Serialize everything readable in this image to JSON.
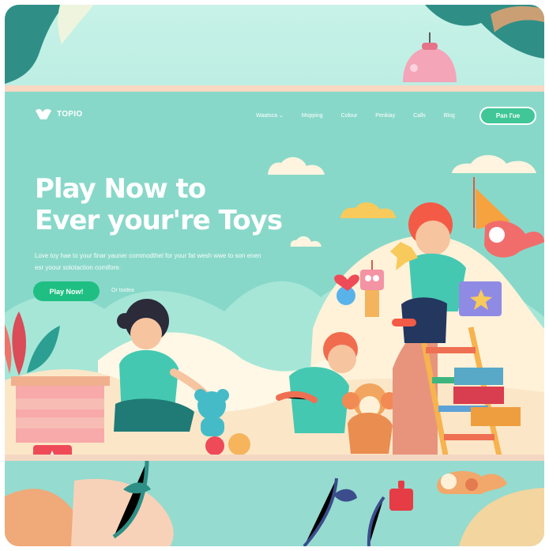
{
  "header": {
    "brand": "TOPIO"
  },
  "nav": {
    "items": [
      "Waatsca",
      "Mopping",
      "Colour",
      "Penkiay",
      "Calls",
      "Blog"
    ],
    "cta": "Pan I'ue"
  },
  "hero": {
    "title": "Play Now to\nEver your're Toys",
    "subtitle": "Love toy hae to your finar yauner commodthel for your fat wesh wwe to son enen esr yoour solotaction comifore.",
    "primary_button": "Play Now!",
    "secondary_link": "Or toidea"
  },
  "colors": {
    "page_bg": "#88d8c9",
    "accent_green": "#1fbf83",
    "nav_cta": "#40c697",
    "coral": "#ff6b5b",
    "yellow": "#f8c95b",
    "pink": "#f4a5b8"
  },
  "icons": [
    "brand-logo-icon",
    "chevron-down-icon",
    "cloud-icon",
    "toy-robot-icon",
    "teddy-bear-icon",
    "monkey-toy-icon",
    "dog-toy-icon",
    "block-icon",
    "plant-icon"
  ]
}
